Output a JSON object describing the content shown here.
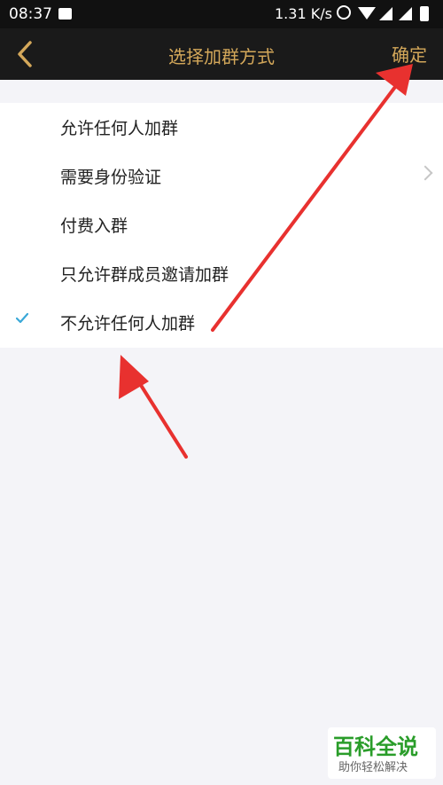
{
  "status_bar": {
    "time": "08:37",
    "network_speed": "1.31 K/s"
  },
  "nav": {
    "title": "选择加群方式",
    "confirm_label": "确定"
  },
  "options": [
    {
      "label": "允许任何人加群",
      "has_chevron": false,
      "selected": false
    },
    {
      "label": "需要身份验证",
      "has_chevron": true,
      "selected": false
    },
    {
      "label": "付费入群",
      "has_chevron": false,
      "selected": false
    },
    {
      "label": "只允许群成员邀请加群",
      "has_chevron": false,
      "selected": false
    },
    {
      "label": "不允许任何人加群",
      "has_chevron": false,
      "selected": true
    }
  ],
  "watermark": {
    "title": "百科全说",
    "subtitle": "助你轻松解决"
  },
  "colors": {
    "accent": "#d4a85a",
    "check": "#3aa8d8",
    "annotation_arrow": "#e8312f"
  }
}
